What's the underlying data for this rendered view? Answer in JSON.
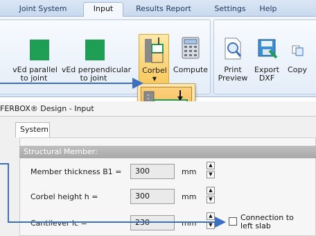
{
  "tabs": [
    {
      "label": "Joint System"
    },
    {
      "label": "Input"
    },
    {
      "label": "Results Report"
    },
    {
      "label": "Settings"
    },
    {
      "label": "Help"
    }
  ],
  "ribbon": {
    "vedParallel": {
      "line1": "vEd parallel",
      "line2": "to joint"
    },
    "vedPerpendicular": {
      "line1": "vEd perpendicular",
      "line2": "to joint"
    },
    "corbel": {
      "label": "Corbel"
    },
    "compute": {
      "label": "Compute"
    },
    "printPreview": {
      "line1": "Print",
      "line2": "Preview"
    },
    "exportDxf": {
      "line1": "Export",
      "line2": "DXF"
    },
    "copy": {
      "label": "Copy"
    }
  },
  "window": {
    "title": "FERBOX® Design - Input"
  },
  "systemTab": {
    "label": "System"
  },
  "structuralMember": {
    "header": "Structural Member:",
    "fields": [
      {
        "label": "Member thickness B1 =",
        "value": "300",
        "unit": "mm"
      },
      {
        "label": "Corbel height h =",
        "value": "300",
        "unit": "mm"
      },
      {
        "label": "Cantilever lc =",
        "value": "230",
        "unit": "mm"
      }
    ],
    "checkbox": {
      "line1": "Connection to",
      "line2": "left slab",
      "checked": false
    }
  },
  "colors": {
    "accent": "#3b6fc4",
    "ribbonSelected": "#f7c24f",
    "iconGreen": "#1f9f56"
  }
}
